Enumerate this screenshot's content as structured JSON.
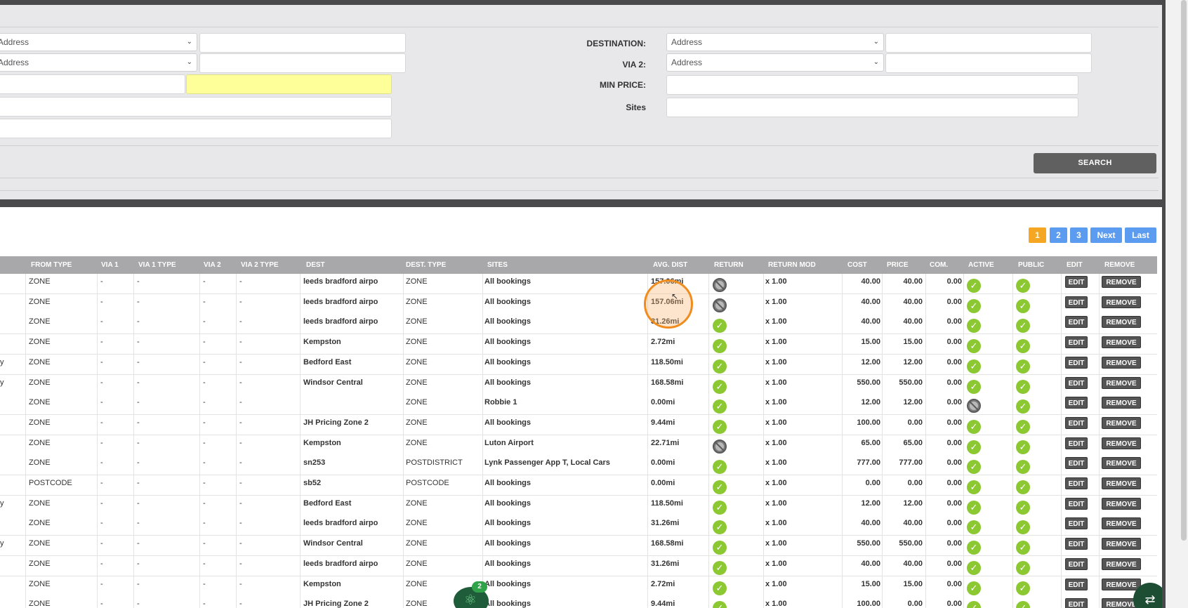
{
  "form": {
    "left": {
      "select1": "Address",
      "select2": "Address"
    },
    "right": {
      "destination_label": "DESTINATION:",
      "destination_select": "Address",
      "via2_label": "VIA 2:",
      "via2_select": "Address",
      "min_price_label": "MIN PRICE:",
      "sites_label": "Sites"
    },
    "search_label": "SEARCH"
  },
  "pagination": {
    "pages": [
      "1",
      "2",
      "3"
    ],
    "next": "Next",
    "last": "Last",
    "current": "1"
  },
  "table": {
    "headers": [
      "FROM TYPE",
      "VIA 1",
      "VIA 1 TYPE",
      "VIA 2",
      "VIA 2 TYPE",
      "DEST",
      "DEST. TYPE",
      "SITES",
      "AVG. DIST",
      "RETURN",
      "RETURN MOD",
      "COST",
      "PRICE",
      "COM.",
      "ACTIVE",
      "PUBLIC",
      "EDIT",
      "REMOVE"
    ],
    "edit_label": "EDIT",
    "remove_label": "REMOVE",
    "rows": [
      {
        "lead": "",
        "from_type": "ZONE",
        "via1": "-",
        "via1_type": "-",
        "via2": "-",
        "via2_type": "-",
        "dest": "leeds bradford airpo",
        "dest_type": "ZONE",
        "sites": "All bookings",
        "dist": "157.06mi",
        "return": false,
        "mod": "x 1.00",
        "cost": "40.00",
        "price": "40.00",
        "com": "0.00",
        "active": true,
        "public": true
      },
      {
        "lead": "",
        "from_type": "ZONE",
        "via1": "-",
        "via1_type": "-",
        "via2": "-",
        "via2_type": "-",
        "dest": "leeds bradford airpo",
        "dest_type": "ZONE",
        "sites": "All bookings",
        "dist": "157.06mi",
        "return": false,
        "mod": "x 1.00",
        "cost": "40.00",
        "price": "40.00",
        "com": "0.00",
        "active": true,
        "public": true
      },
      {
        "lead": "",
        "from_type": "ZONE",
        "via1": "-",
        "via1_type": "-",
        "via2": "-",
        "via2_type": "-",
        "dest": "leeds bradford airpo",
        "dest_type": "ZONE",
        "sites": "All bookings",
        "dist": "31.26mi",
        "return": true,
        "mod": "x 1.00",
        "cost": "40.00",
        "price": "40.00",
        "com": "0.00",
        "active": true,
        "public": true
      },
      {
        "lead": "",
        "from_type": "ZONE",
        "via1": "-",
        "via1_type": "-",
        "via2": "-",
        "via2_type": "-",
        "dest": "Kempston",
        "dest_type": "ZONE",
        "sites": "All bookings",
        "dist": "2.72mi",
        "return": true,
        "mod": "x 1.00",
        "cost": "15.00",
        "price": "15.00",
        "com": "0.00",
        "active": true,
        "public": true
      },
      {
        "lead": "y",
        "from_type": "ZONE",
        "via1": "-",
        "via1_type": "-",
        "via2": "-",
        "via2_type": "-",
        "dest": "Bedford East",
        "dest_type": "ZONE",
        "sites": "All bookings",
        "dist": "118.50mi",
        "return": true,
        "mod": "x 1.00",
        "cost": "12.00",
        "price": "12.00",
        "com": "0.00",
        "active": true,
        "public": true
      },
      {
        "lead": "y",
        "from_type": "ZONE",
        "via1": "-",
        "via1_type": "-",
        "via2": "-",
        "via2_type": "-",
        "dest": "Windsor Central",
        "dest_type": "ZONE",
        "sites": "All bookings",
        "dist": "168.58mi",
        "return": true,
        "mod": "x 1.00",
        "cost": "550.00",
        "price": "550.00",
        "com": "0.00",
        "active": true,
        "public": true
      },
      {
        "lead": "",
        "from_type": "ZONE",
        "via1": "-",
        "via1_type": "-",
        "via2": "-",
        "via2_type": "-",
        "dest": "",
        "dest_type": "ZONE",
        "sites": "Robbie 1",
        "dist": "0.00mi",
        "return": true,
        "mod": "x 1.00",
        "cost": "12.00",
        "price": "12.00",
        "com": "0.00",
        "active": false,
        "public": true
      },
      {
        "lead": "",
        "from_type": "ZONE",
        "via1": "-",
        "via1_type": "-",
        "via2": "-",
        "via2_type": "-",
        "dest": "JH Pricing Zone 2",
        "dest_type": "ZONE",
        "sites": "All bookings",
        "dist": "9.44mi",
        "return": true,
        "mod": "x 1.00",
        "cost": "100.00",
        "price": "0.00",
        "com": "0.00",
        "active": true,
        "public": true
      },
      {
        "lead": "",
        "from_type": "ZONE",
        "via1": "-",
        "via1_type": "-",
        "via2": "-",
        "via2_type": "-",
        "dest": "Kempston",
        "dest_type": "ZONE",
        "sites": "Luton Airport",
        "dist": "22.71mi",
        "return": false,
        "mod": "x 1.00",
        "cost": "65.00",
        "price": "65.00",
        "com": "0.00",
        "active": true,
        "public": true
      },
      {
        "lead": "",
        "from_type": "ZONE",
        "via1": "-",
        "via1_type": "-",
        "via2": "-",
        "via2_type": "-",
        "dest": "sn253",
        "dest_type": "POSTDISTRICT",
        "sites": "Lynk Passenger App T, Local Cars",
        "dist": "0.00mi",
        "return": true,
        "mod": "x 1.00",
        "cost": "777.00",
        "price": "777.00",
        "com": "0.00",
        "active": true,
        "public": true
      },
      {
        "lead": "",
        "from_type": "POSTCODE",
        "via1": "-",
        "via1_type": "-",
        "via2": "-",
        "via2_type": "-",
        "dest": "sb52",
        "dest_type": "POSTCODE",
        "sites": "All bookings",
        "dist": "0.00mi",
        "return": true,
        "mod": "x 1.00",
        "cost": "0.00",
        "price": "0.00",
        "com": "0.00",
        "active": true,
        "public": true
      },
      {
        "lead": "y",
        "from_type": "ZONE",
        "via1": "-",
        "via1_type": "-",
        "via2": "-",
        "via2_type": "-",
        "dest": "Bedford East",
        "dest_type": "ZONE",
        "sites": "All bookings",
        "dist": "118.50mi",
        "return": true,
        "mod": "x 1.00",
        "cost": "12.00",
        "price": "12.00",
        "com": "0.00",
        "active": true,
        "public": true
      },
      {
        "lead": "",
        "from_type": "ZONE",
        "via1": "-",
        "via1_type": "-",
        "via2": "-",
        "via2_type": "-",
        "dest": "leeds bradford airpo",
        "dest_type": "ZONE",
        "sites": "All bookings",
        "dist": "31.26mi",
        "return": true,
        "mod": "x 1.00",
        "cost": "40.00",
        "price": "40.00",
        "com": "0.00",
        "active": true,
        "public": true
      },
      {
        "lead": "y",
        "from_type": "ZONE",
        "via1": "-",
        "via1_type": "-",
        "via2": "-",
        "via2_type": "-",
        "dest": "Windsor Central",
        "dest_type": "ZONE",
        "sites": "All bookings",
        "dist": "168.58mi",
        "return": true,
        "mod": "x 1.00",
        "cost": "550.00",
        "price": "550.00",
        "com": "0.00",
        "active": true,
        "public": true
      },
      {
        "lead": "",
        "from_type": "ZONE",
        "via1": "-",
        "via1_type": "-",
        "via2": "-",
        "via2_type": "-",
        "dest": "leeds bradford airpo",
        "dest_type": "ZONE",
        "sites": "All bookings",
        "dist": "31.26mi",
        "return": true,
        "mod": "x 1.00",
        "cost": "40.00",
        "price": "40.00",
        "com": "0.00",
        "active": true,
        "public": true
      },
      {
        "lead": "",
        "from_type": "ZONE",
        "via1": "-",
        "via1_type": "-",
        "via2": "-",
        "via2_type": "-",
        "dest": "Kempston",
        "dest_type": "ZONE",
        "sites": "All bookings",
        "dist": "2.72mi",
        "return": true,
        "mod": "x 1.00",
        "cost": "15.00",
        "price": "15.00",
        "com": "0.00",
        "active": true,
        "public": true
      },
      {
        "lead": "",
        "from_type": "ZONE",
        "via1": "-",
        "via1_type": "-",
        "via2": "-",
        "via2_type": "-",
        "dest": "JH Pricing Zone 2",
        "dest_type": "ZONE",
        "sites": "All bookings",
        "dist": "9.44mi",
        "return": true,
        "mod": "x 1.00",
        "cost": "100.00",
        "price": "0.00",
        "com": "0.00",
        "active": true,
        "public": true
      }
    ]
  },
  "widget": {
    "badge": "2",
    "icon": "atom-icon"
  },
  "swap_icon": "swap-icon",
  "colors": {
    "accent_orange": "#f5a623",
    "pager_blue": "#5b9bf0",
    "ok_green": "#8cc832"
  }
}
